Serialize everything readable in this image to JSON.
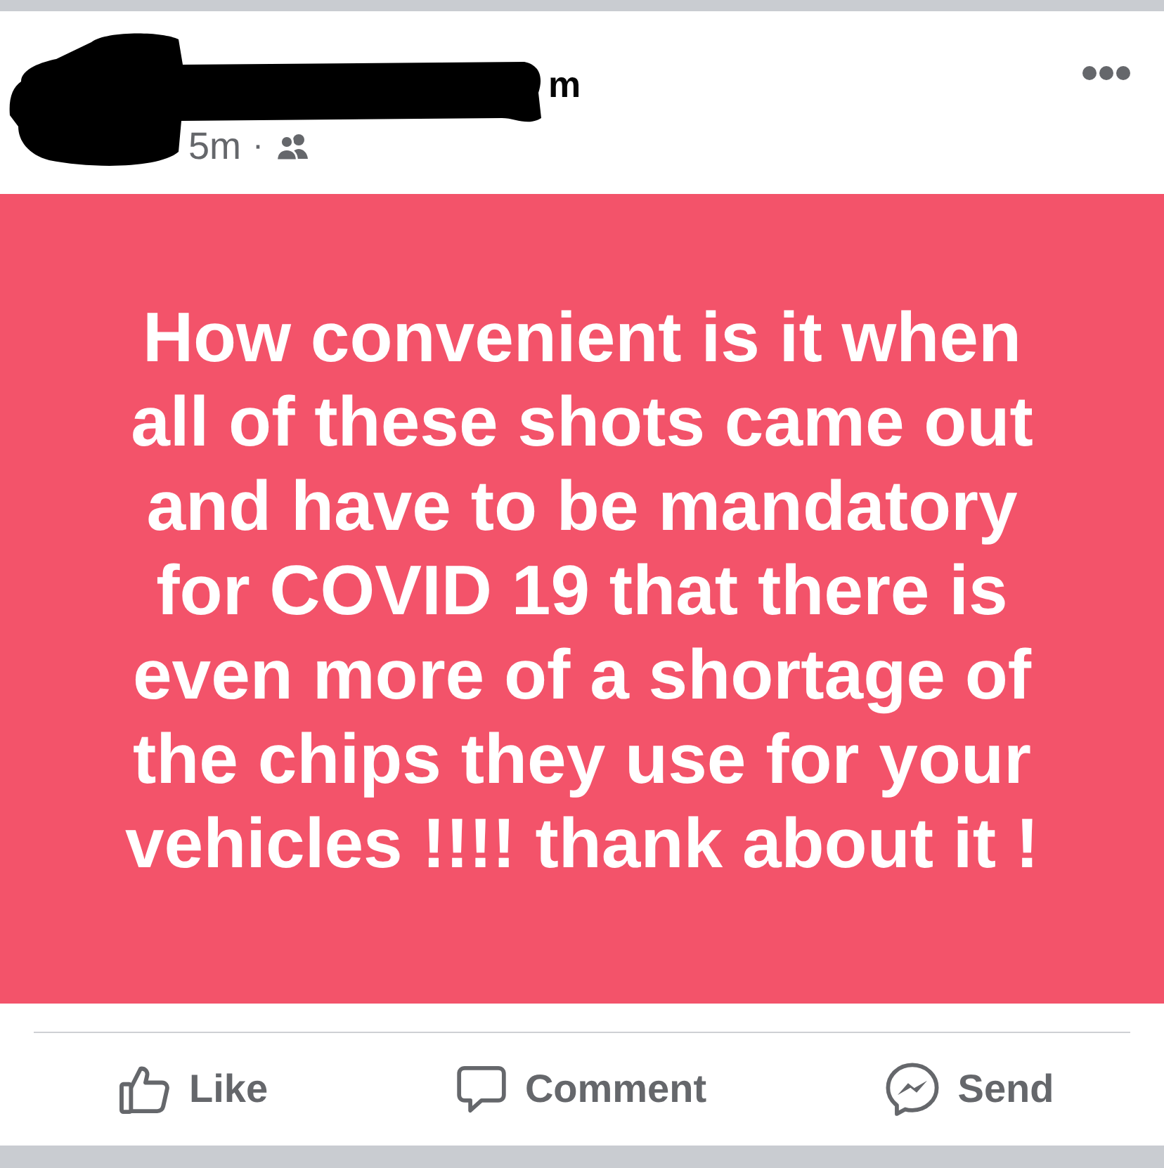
{
  "header": {
    "author_name": "m",
    "time": "5m",
    "separator": "·"
  },
  "post": {
    "text": "How convenient is it when all of these shots came out and have to be mandatory for COVID 19 that there is even more of a shortage of the chips they use for your vehicles !!!! thank about it !"
  },
  "actions": [
    {
      "kind": "like",
      "label": "Like"
    },
    {
      "kind": "comment",
      "label": "Comment"
    },
    {
      "kind": "send",
      "label": "Send"
    }
  ]
}
